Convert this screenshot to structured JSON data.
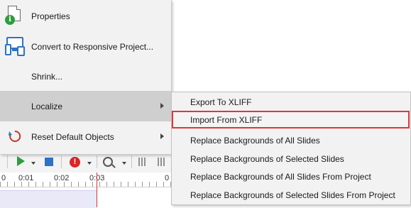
{
  "context_menu": {
    "items": [
      {
        "label": "Properties",
        "icon": "properties-icon"
      },
      {
        "label": "Convert to Responsive Project...",
        "icon": "responsive-project-icon"
      },
      {
        "label": "Shrink...",
        "icon": ""
      },
      {
        "label": "Localize",
        "icon": "",
        "has_submenu": true,
        "active": true
      },
      {
        "label": "Reset Default Objects",
        "icon": "reset-icon",
        "has_submenu": true
      }
    ]
  },
  "localize_submenu": {
    "items": [
      {
        "label": "Export To XLIFF"
      },
      {
        "label": "Import From XLIFF",
        "highlighted": true
      },
      {
        "label": "Replace Backgrounds of All Slides"
      },
      {
        "label": "Replace Backgrounds of Selected Slides"
      },
      {
        "label": "Replace Backgrounds of All Slides From Project"
      },
      {
        "label": "Replace Backgrounds of Selected Slides From Project"
      }
    ]
  },
  "timeline": {
    "ticks": [
      "0",
      "0:01",
      "0:02",
      "0:03",
      "0"
    ]
  },
  "colors": {
    "highlight_border": "#e0363a",
    "play": "#2e9c3f",
    "stop": "#2b73c6",
    "warning": "#d92525"
  }
}
